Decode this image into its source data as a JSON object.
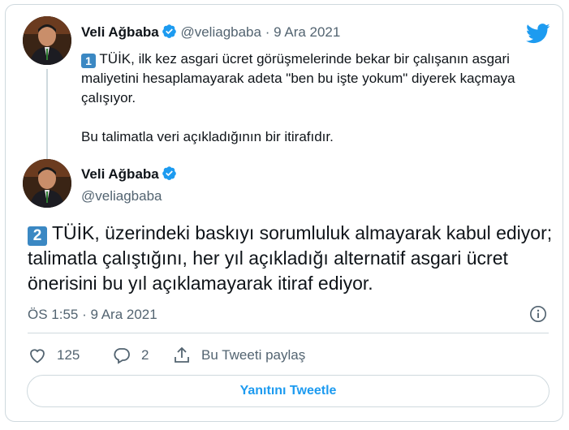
{
  "parent_tweet": {
    "author_name": "Veli Ağbaba",
    "author_handle": "@veliagbaba",
    "separator": "·",
    "date": "9 Ara 2021",
    "number_emoji": "1",
    "paragraph_1": "TÜİK, ilk kez asgari ücret görüşmelerinde bekar bir çalışanın asgari maliyetini hesaplamayarak adeta \"ben bu işte yokum\" diyerek kaçmaya çalışıyor.",
    "paragraph_2": "Bu talimatla veri açıkladığının bir itirafıdır."
  },
  "main_tweet": {
    "author_name": "Veli Ağbaba",
    "author_handle": "@veliagbaba",
    "number_emoji": "2",
    "text": "TÜİK, üzerindeki baskıyı sorumluluk almayarak kabul ediyor; talimatla çalıştığını, her yıl açıkladığı alternatif asgari ücret önerisini bu yıl açıklamayarak itiraf ediyor.",
    "timestamp": "ÖS 1:55 · 9 Ara 2021"
  },
  "actions": {
    "like_count": "125",
    "reply_count": "2",
    "share_label": "Bu Tweeti paylaş"
  },
  "reply_button_label": "Yanıtını Tweetle",
  "colors": {
    "brand_blue": "#1d9bf0",
    "verified_blue": "#1d9bf0",
    "keycap_blue": "#3b88c3",
    "secondary_text": "#536471",
    "border": "#cfd9de"
  },
  "icons": [
    "twitter-logo-icon",
    "verified-badge-icon",
    "info-icon",
    "heart-icon",
    "reply-bubble-icon",
    "share-icon"
  ]
}
